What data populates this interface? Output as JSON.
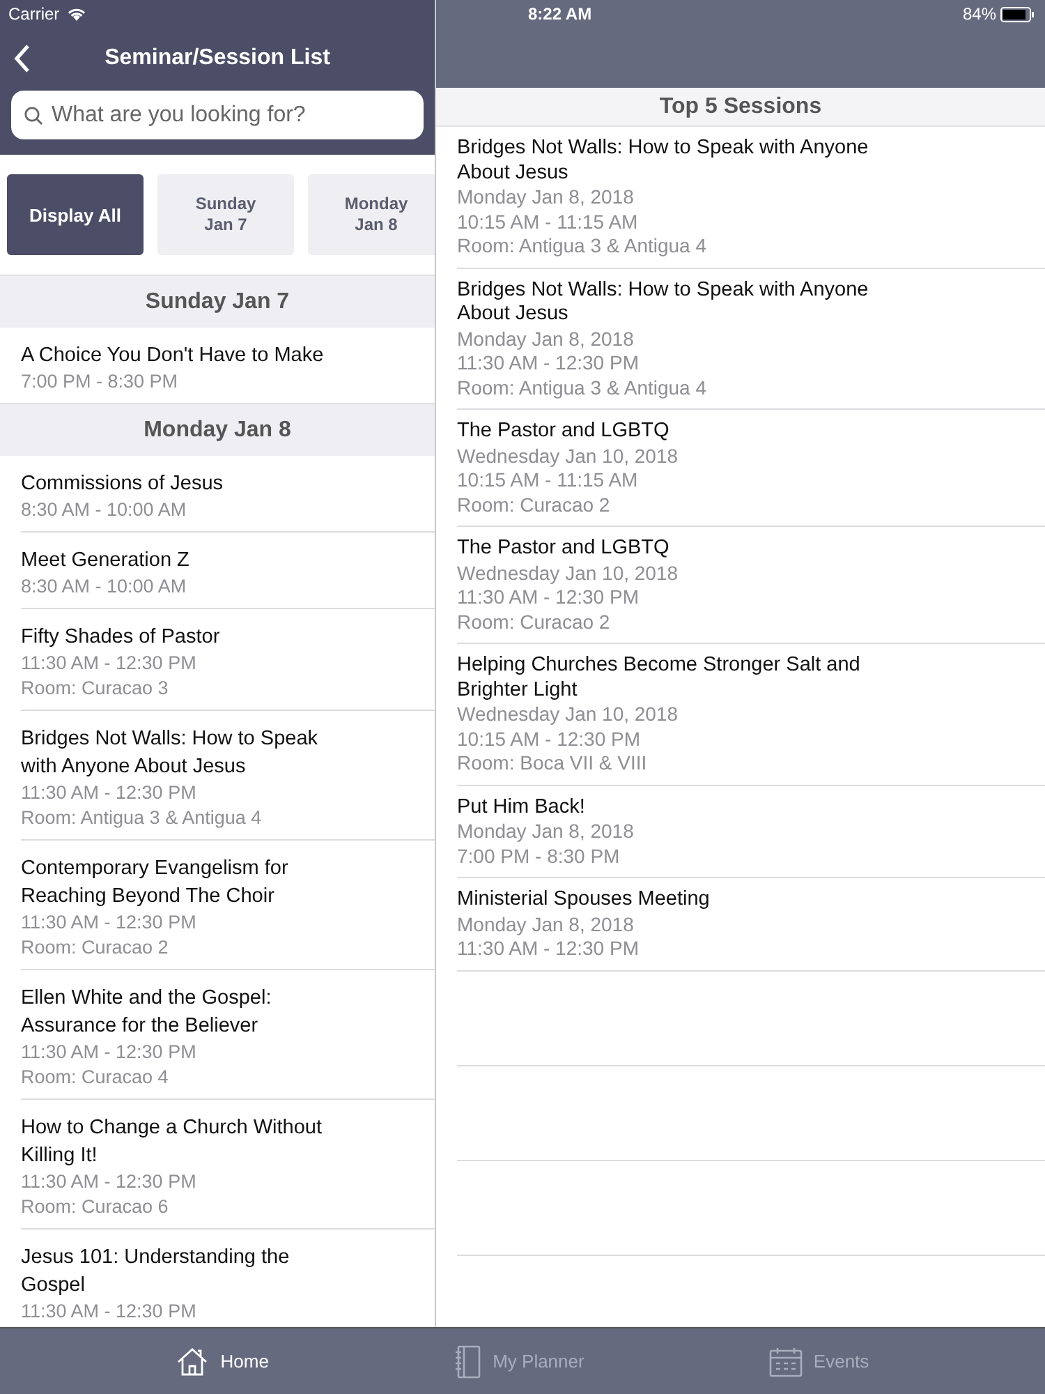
{
  "status_bar": {
    "carrier": "Carrier",
    "time": "8:22 AM",
    "battery": "84%"
  },
  "left_header": {
    "title": "Seminar/Session List"
  },
  "search": {
    "placeholder": "What are you looking for?"
  },
  "day_filters": [
    {
      "label": "Display All",
      "selected": true
    },
    {
      "label": "Sunday\nJan 7",
      "selected": false
    },
    {
      "label": "Monday\nJan 8",
      "selected": false
    }
  ],
  "sections": [
    {
      "heading": "Sunday Jan 7",
      "sessions": [
        {
          "title": "A Choice You Don't Have to Make",
          "time": "7:00 PM - 8:30 PM"
        }
      ]
    },
    {
      "heading": "Monday Jan 8",
      "sessions": [
        {
          "title": "Commissions of Jesus",
          "time": "8:30 AM - 10:00 AM"
        },
        {
          "title": "Meet Generation Z",
          "time": "8:30 AM - 10:00 AM"
        },
        {
          "title": "Fifty Shades of Pastor",
          "time": "11:30 AM - 12:30 PM",
          "room": "Room: Curacao 3"
        },
        {
          "title": "Bridges Not Walls: How to Speak with Anyone About Jesus",
          "time": "11:30 AM - 12:30 PM",
          "room": "Room: Antigua 3 & Antigua 4"
        },
        {
          "title": "Contemporary Evangelism for Reaching Beyond The Choir",
          "time": "11:30 AM - 12:30 PM",
          "room": "Room: Curacao 2"
        },
        {
          "title": "Ellen White and the Gospel: Assurance for the Believer",
          "time": "11:30 AM - 12:30 PM",
          "room": "Room: Curacao 4"
        },
        {
          "title": "How to Change a Church Without Killing It!",
          "time": "11:30 AM - 12:30 PM",
          "room": "Room: Curacao 6"
        },
        {
          "title": "Jesus 101: Understanding the Gospel",
          "time": "11:30 AM - 12:30 PM"
        }
      ]
    }
  ],
  "top_sessions": {
    "heading": "Top 5 Sessions",
    "sessions": [
      {
        "title": "Bridges Not Walls: How to Speak with Anyone About Jesus",
        "date": "Monday Jan 8, 2018",
        "time": "10:15 AM - 11:15 AM",
        "room": "Room: Antigua 3 & Antigua 4"
      },
      {
        "title": "Bridges Not Walls: How to Speak with Anyone About Jesus",
        "date": "Monday Jan 8, 2018",
        "time": "11:30 AM - 12:30 PM",
        "room": "Room: Antigua 3 & Antigua 4"
      },
      {
        "title": "The Pastor and LGBTQ",
        "date": "Wednesday Jan 10, 2018",
        "time": "10:15 AM - 11:15 AM",
        "room": "Room: Curacao 2"
      },
      {
        "title": "The Pastor and LGBTQ",
        "date": "Wednesday Jan 10, 2018",
        "time": "11:30 AM - 12:30 PM",
        "room": "Room: Curacao 2"
      },
      {
        "title": "Helping Churches Become Stronger Salt and Brighter Light",
        "date": "Wednesday Jan 10, 2018",
        "time": "10:15 AM - 12:30 PM",
        "room": "Room: Boca VII & VIII"
      },
      {
        "title": "Put Him Back!",
        "date": "Monday Jan 8, 2018",
        "time": "7:00 PM - 8:30 PM"
      },
      {
        "title": "Ministerial Spouses Meeting",
        "date": "Monday Jan 8, 2018",
        "time": "11:30 AM - 12:30 PM"
      }
    ]
  },
  "tab_bar": [
    {
      "label": "Home",
      "kind": "home",
      "selected": true
    },
    {
      "label": "My Planner",
      "kind": "planner",
      "selected": false
    },
    {
      "label": "Events",
      "kind": "events",
      "selected": false
    }
  ]
}
